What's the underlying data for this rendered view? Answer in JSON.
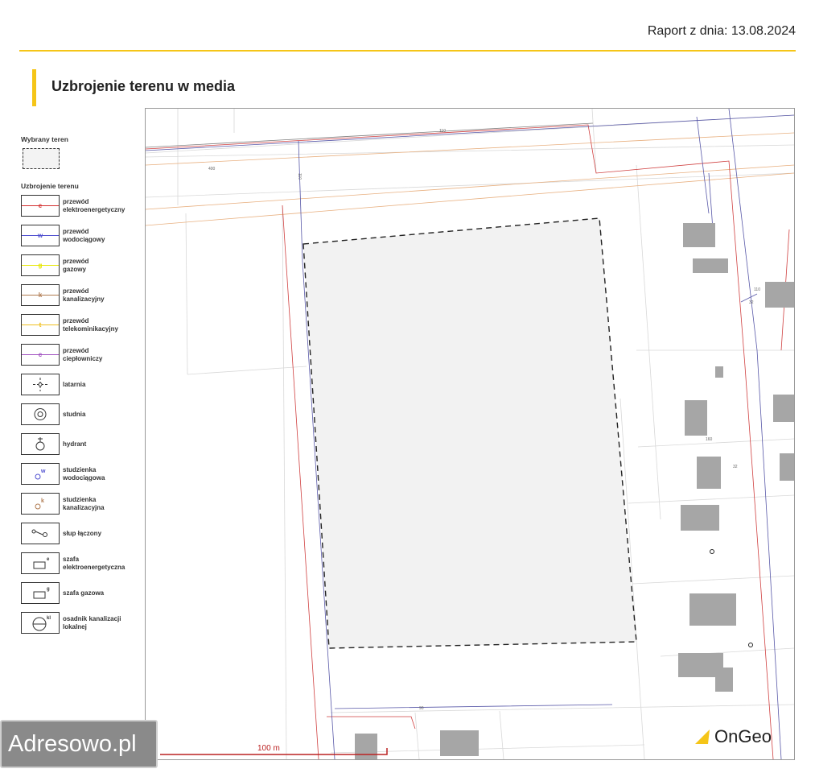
{
  "header": {
    "report_date": "Raport z dnia: 13.08.2024"
  },
  "section": {
    "title": "Uzbrojenie terenu w media"
  },
  "legend": {
    "selected_heading": "Wybrany teren",
    "utilities_heading": "Uzbrojenie terenu",
    "items": [
      {
        "label1": "przewód",
        "label2": "elektroenergetyczny",
        "letter": "e",
        "color": "#d32f2f",
        "icon": "power-line-icon"
      },
      {
        "label1": "przewód",
        "label2": "wodociągowy",
        "letter": "w",
        "color": "#5050d0",
        "icon": "water-line-icon"
      },
      {
        "label1": "przewód",
        "label2": "gazowy",
        "letter": "g",
        "color": "#e6e600",
        "icon": "gas-line-icon"
      },
      {
        "label1": "przewód",
        "label2": "kanalizacyjny",
        "letter": "k",
        "color": "#b07a50",
        "icon": "sewer-line-icon"
      },
      {
        "label1": "przewód",
        "label2": "telekominikacyjny",
        "letter": "t",
        "color": "#f0c020",
        "icon": "telecom-line-icon"
      },
      {
        "label1": "przewód",
        "label2": "ciepłowniczy",
        "letter": "c",
        "color": "#a050c0",
        "icon": "heating-line-icon"
      },
      {
        "label1": "latarnia",
        "label2": "",
        "icon": "street-lamp-icon"
      },
      {
        "label1": "studnia",
        "label2": "",
        "icon": "well-icon"
      },
      {
        "label1": "hydrant",
        "label2": "",
        "icon": "hydrant-icon"
      },
      {
        "label1": "studzienka",
        "label2": "wodociągowa",
        "letter": "w",
        "color": "#5050d0",
        "icon": "water-manhole-icon"
      },
      {
        "label1": "studzienka",
        "label2": "kanalizacyjna",
        "letter": "k",
        "color": "#b07a50",
        "icon": "sewer-manhole-icon"
      },
      {
        "label1": "słup łączony",
        "label2": "",
        "icon": "combined-pole-icon"
      },
      {
        "label1": "szafa",
        "label2": "elektroenergetyczna",
        "letter": "e",
        "icon": "electrical-cabinet-icon"
      },
      {
        "label1": "szafa gazowa",
        "label2": "",
        "letter": "g",
        "icon": "gas-cabinet-icon"
      },
      {
        "label1": "osadnik kanalizacji",
        "label2": "lokalnej",
        "letter": "kl",
        "icon": "septic-tank-icon"
      }
    ]
  },
  "map": {
    "labels": {
      "l1": "110",
      "l2": "400",
      "l3": "110",
      "l4": "90",
      "l5": "32",
      "l6": "110",
      "l7": "160",
      "l8": "32"
    },
    "scale": "100 m",
    "colors": {
      "power": "#d32f2f",
      "water": "#5050a0",
      "sewer": "#e0a070",
      "building": "#a6a6a6",
      "parcel": "#f2f2f2"
    }
  },
  "branding": {
    "watermark": "Adresowo.pl",
    "logo": "OnGeo",
    "accent": "#f5c518"
  }
}
